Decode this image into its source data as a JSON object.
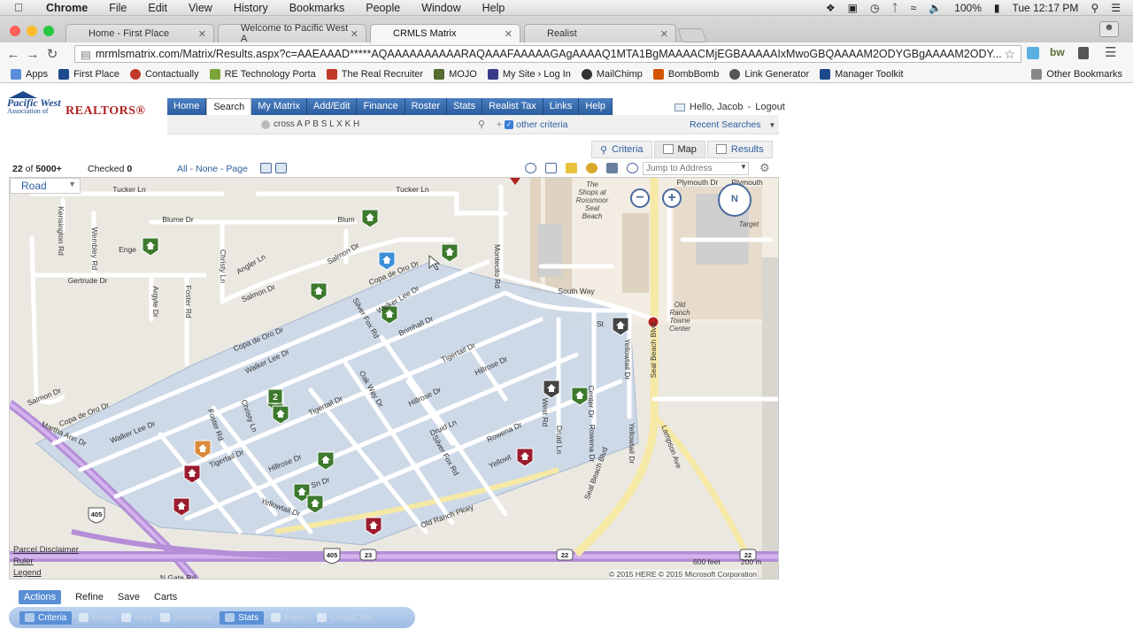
{
  "os_menubar": {
    "apple_icon": "apple-icon",
    "app": "Chrome",
    "items": [
      "File",
      "Edit",
      "View",
      "History",
      "Bookmarks",
      "People",
      "Window",
      "Help"
    ],
    "battery": "100%",
    "clock": "Tue 12:17 PM"
  },
  "tabs": [
    {
      "title": "Home - First Place",
      "active": false,
      "icon_color": "#1d4a8c"
    },
    {
      "title": "Welcome to Pacific West A",
      "active": false,
      "icon_color": "#b22222"
    },
    {
      "title": "CRMLS Matrix",
      "active": true,
      "icon_color": "#b22222"
    },
    {
      "title": "Realist",
      "active": false,
      "icon_color": "#b22222"
    }
  ],
  "address": {
    "url": "mrmlsmatrix.com/Matrix/Results.aspx?c=AAEAAAD*****AQAAAAAAAAAARAQAAAFAAAAAGAgAAAAQ1MTA1BgMAAAACMjEGBAAAAAIxMwoGBQAAAAM2ODYGBgAAAAM2ODY..."
  },
  "bookmarks": [
    {
      "label": "Apps",
      "color": "#5b8dd9"
    },
    {
      "label": "First Place",
      "color": "#1d4a8c"
    },
    {
      "label": "Contactually",
      "color": "#c0392b"
    },
    {
      "label": "RE Technology Porta",
      "color": "#7aa33a"
    },
    {
      "label": "The Real Recruiter",
      "color": "#c0392b"
    },
    {
      "label": "MOJO",
      "color": "#556b2f"
    },
    {
      "label": "My Site › Log In",
      "color": "#3a3a8a"
    },
    {
      "label": "MailChimp",
      "color": "#333333"
    },
    {
      "label": "BombBomb",
      "color": "#d35400"
    },
    {
      "label": "Link Generator",
      "color": "#555555"
    },
    {
      "label": "Manager Toolkit",
      "color": "#1d4a8c"
    },
    {
      "label": "Other Bookmarks",
      "color": "#888888"
    }
  ],
  "site": {
    "logo_line1": "Pacific West",
    "logo_line2": "Association of",
    "logo_line3": "REALTORS®",
    "nav": [
      "Home",
      "Search",
      "My Matrix",
      "Add/Edit",
      "Finance",
      "Roster",
      "Stats",
      "Realist Tax",
      "Links",
      "Help"
    ],
    "nav_selected": "Search",
    "greeting": "Hello, Jacob",
    "logout": "Logout",
    "criteria_summary": "cross A P B S L X K H",
    "other_criteria": "other criteria",
    "recent_searches": "Recent Searches",
    "view_tabs": [
      "Criteria",
      "Map",
      "Results"
    ],
    "view_selected": "Map"
  },
  "results": {
    "count_shown": "22",
    "count_of": "of",
    "count_total": "5000+",
    "checked_label": "Checked",
    "checked_count": "0",
    "select_links": "All - None - Page",
    "jump_placeholder": "Jump to Address"
  },
  "map": {
    "mode": "Road",
    "compass": "N",
    "streets": [
      "Tucker Ln",
      "Tucker Ln",
      "Blume Dr",
      "Blum",
      "Kensington Rd",
      "Wembley Rd",
      "Enge",
      "Christy Ln",
      "Angler Ln",
      "Salmon Dr",
      "Salmon Dr",
      "Gertrude Dr",
      "Argyle Dr",
      "Foster Rd",
      "Copa de Oro Dr",
      "Copa de Oro Dr",
      "Silver Fox Rd",
      "Walker Lee Dr",
      "Brimhall Dr",
      "Montecito Rd",
      "Tigertail Dr",
      "Hillrose Dr",
      "Walker Lee Dr",
      "Oak Way Dr",
      "Tigertail Dr",
      "Hillrose Dr",
      "Druid Ln",
      "Rowena Dr",
      "Yellowtail Dr",
      "West Rd",
      "Center Dr",
      "Druid Ln",
      "Rowena Dr",
      "Yellowtail Dr",
      "Salmon Dr",
      "Copa de Oro Dr",
      "Martha Ann Dr",
      "Walker Lee Dr",
      "Foster Rd",
      "Christy Ln",
      "Tigertail Dr",
      "Hillrose Dr",
      "Yellowtail Dr",
      "Silver Fox Rd",
      "Old Ranch Pkwy",
      "Yellowt",
      "Seal Beach Blvd",
      "Seal Beach Blvd",
      "Lampson Ave",
      "South Way",
      "St",
      "Plymouth Dr",
      "Plymouth",
      "N Gate Rd",
      "Sn Dr"
    ],
    "places": [
      "The Shops at Rossmoor Seal Beach",
      "Target",
      "Old Ranch Towne Center"
    ],
    "highways": [
      "405",
      "405",
      "23",
      "22",
      "22"
    ],
    "cluster_count": "2",
    "parcel_disclaimer": "Parcel Disclaimer",
    "ruler": "Ruler",
    "legend": "Legend",
    "scale_feet": "600 feet",
    "scale_m": "200 m",
    "copyright": "© 2015 HERE   © 2015 Microsoft Corporation",
    "pin_colors": {
      "active": "#3d7a2e",
      "sold": "#9b1c2e",
      "pending": "#d98a3b",
      "other": "#444444",
      "school": "#3b8fd8"
    }
  },
  "actions_bar": [
    "Actions",
    "Refine",
    "Save",
    "Carts"
  ],
  "actions_selected": "Actions",
  "bottom_tools": [
    "Criteria",
    "Email",
    "Print",
    "Directions",
    "Stats",
    "Export",
    "CloudCMA"
  ],
  "bottom_enabled": [
    "Criteria",
    "Stats"
  ]
}
